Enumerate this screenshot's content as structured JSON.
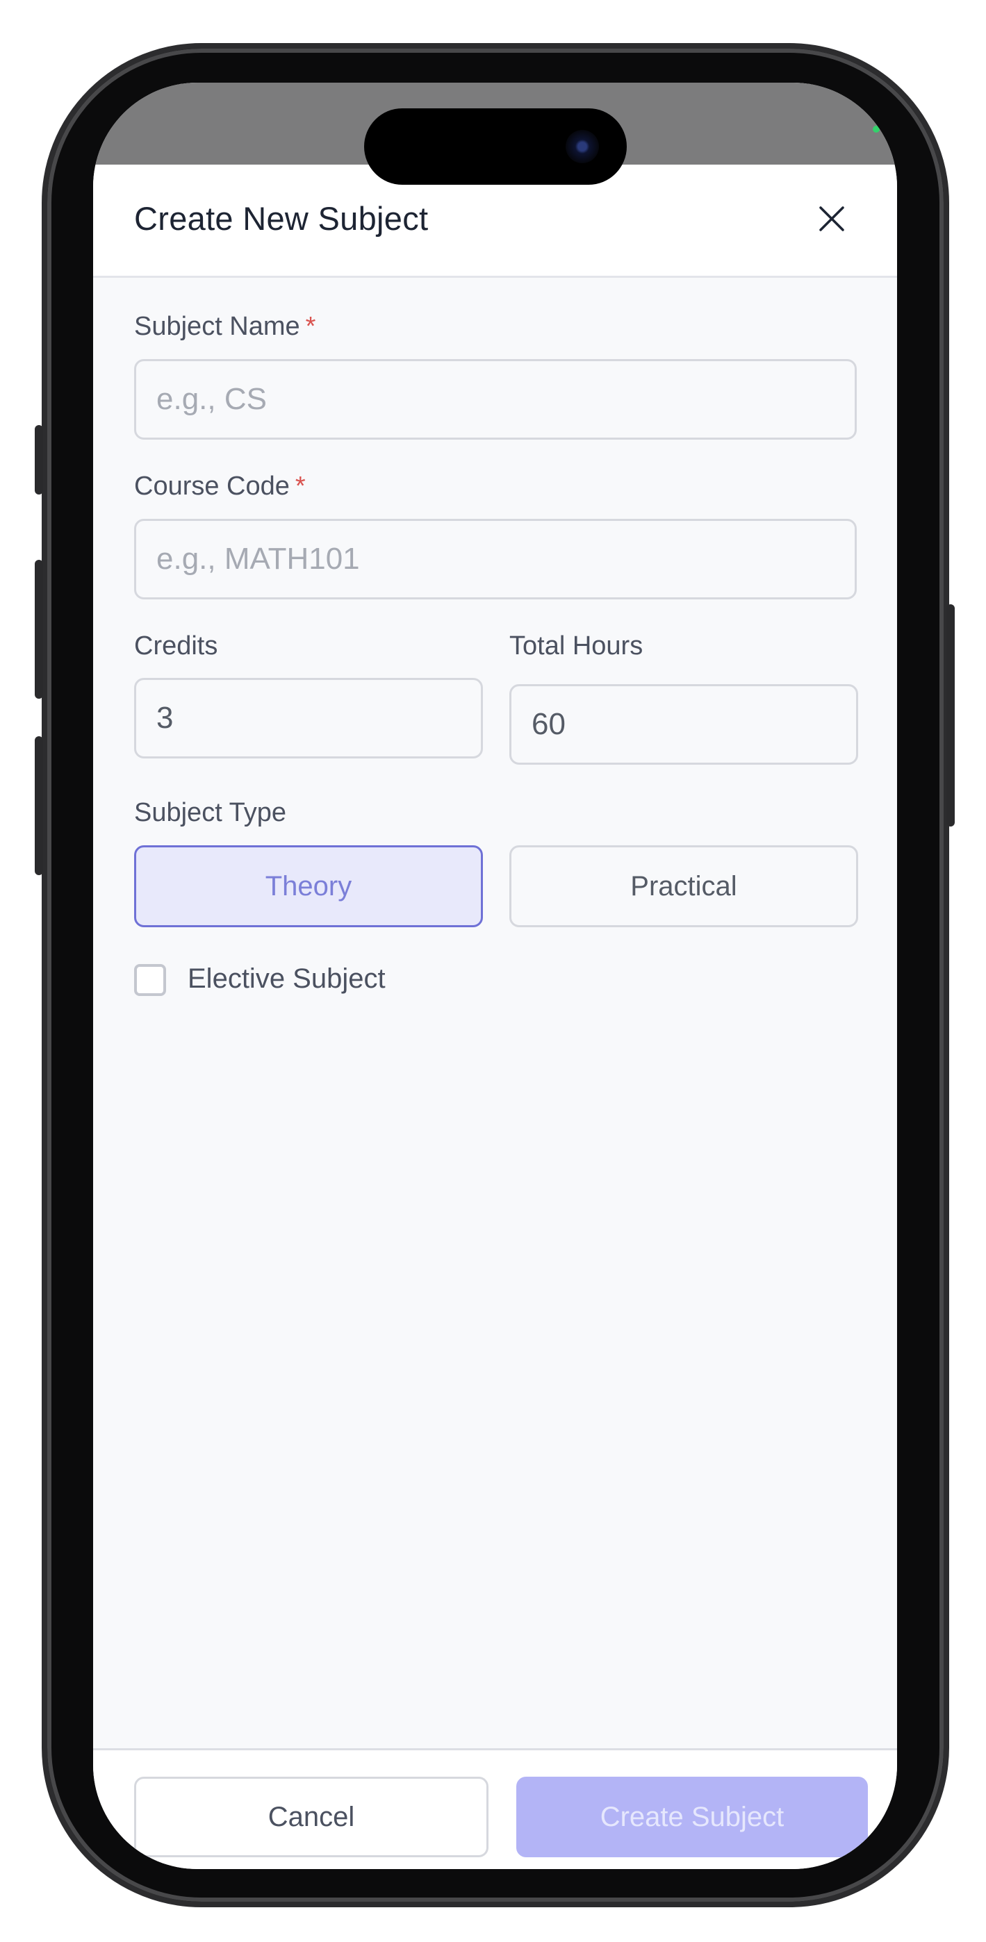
{
  "modal": {
    "title": "Create New Subject",
    "close_icon": "close-icon"
  },
  "fields": {
    "subject_name": {
      "label": "Subject Name",
      "required_mark": "*",
      "placeholder": "e.g., CS",
      "value": ""
    },
    "course_code": {
      "label": "Course Code",
      "required_mark": "*",
      "placeholder": "e.g., MATH101",
      "value": ""
    },
    "credits": {
      "label": "Credits",
      "value": "3"
    },
    "total_hours": {
      "label": "Total Hours",
      "value": "60"
    }
  },
  "subject_type": {
    "label": "Subject Type",
    "options": [
      "Theory",
      "Practical"
    ],
    "selected": "Theory"
  },
  "elective": {
    "label": "Elective Subject",
    "checked": false
  },
  "footer": {
    "cancel_label": "Cancel",
    "create_label": "Create Subject"
  },
  "colors": {
    "accent": "#6f71d6",
    "accent_bg": "#e8e9fb",
    "primary_disabled": "#b3b4f6",
    "required": "#d9534f"
  }
}
